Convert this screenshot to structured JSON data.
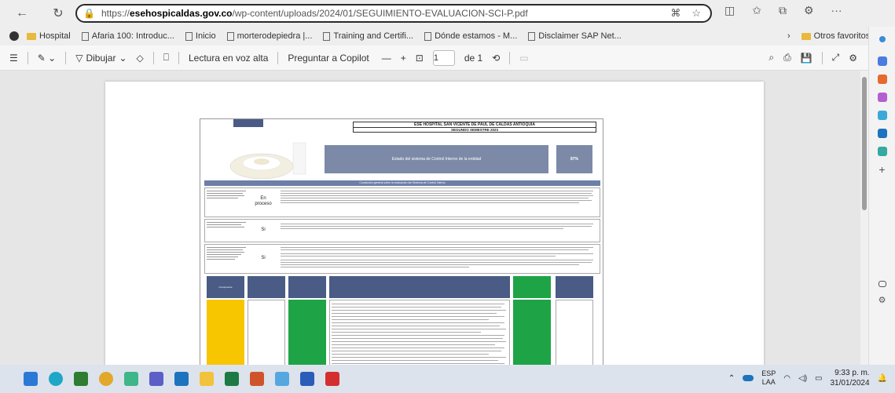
{
  "browser": {
    "url_prefix": "https://",
    "url_host": "esehospicaldas.gov.co",
    "url_path": "/wp-content/uploads/2024/01/SEGUIMIENTO-EVALUACION-SCI-P.pdf"
  },
  "bookmarks": [
    {
      "label": "Hospital",
      "type": "folder"
    },
    {
      "label": "Afaria 100: Introduc...",
      "type": "page"
    },
    {
      "label": "Inicio",
      "type": "page"
    },
    {
      "label": "morterodepiedra |...",
      "type": "page"
    },
    {
      "label": "Training and Certifi...",
      "type": "page"
    },
    {
      "label": "Dónde estamos - M...",
      "type": "page"
    },
    {
      "label": "Disclaimer SAP Net...",
      "type": "page"
    }
  ],
  "other_favorites": "Otros favoritos",
  "pdf_toolbar": {
    "draw": "Dibujar",
    "read_aloud": "Lectura en voz alta",
    "ask_copilot": "Preguntar a Copilot",
    "page_current": "1",
    "page_total": "de 1"
  },
  "document": {
    "title": "ESE HOSPITAL SAN VICENTE DE PAUL DE CALDAS ANTIOQUIA",
    "subtitle": "SEGUNDO SEMESTRE 2023",
    "status_label": "Estado del sistema de Control Interno de la entidad",
    "status_pct": "87%",
    "section": "Conclusión general sobre la evaluación del Sistema de Control Interno",
    "rows": [
      {
        "answer": "En proceso"
      },
      {
        "answer": "Si"
      },
      {
        "answer": "Si"
      }
    ],
    "component_header": "Componente"
  },
  "taskbar": {
    "lang_line1": "ESP",
    "lang_line2": "LAA",
    "time": "9:33 p. m.",
    "date": "31/01/2024"
  },
  "colors": {
    "table_blue": "#4a5b86",
    "yellow": "#f7c600",
    "green": "#1ea446"
  }
}
